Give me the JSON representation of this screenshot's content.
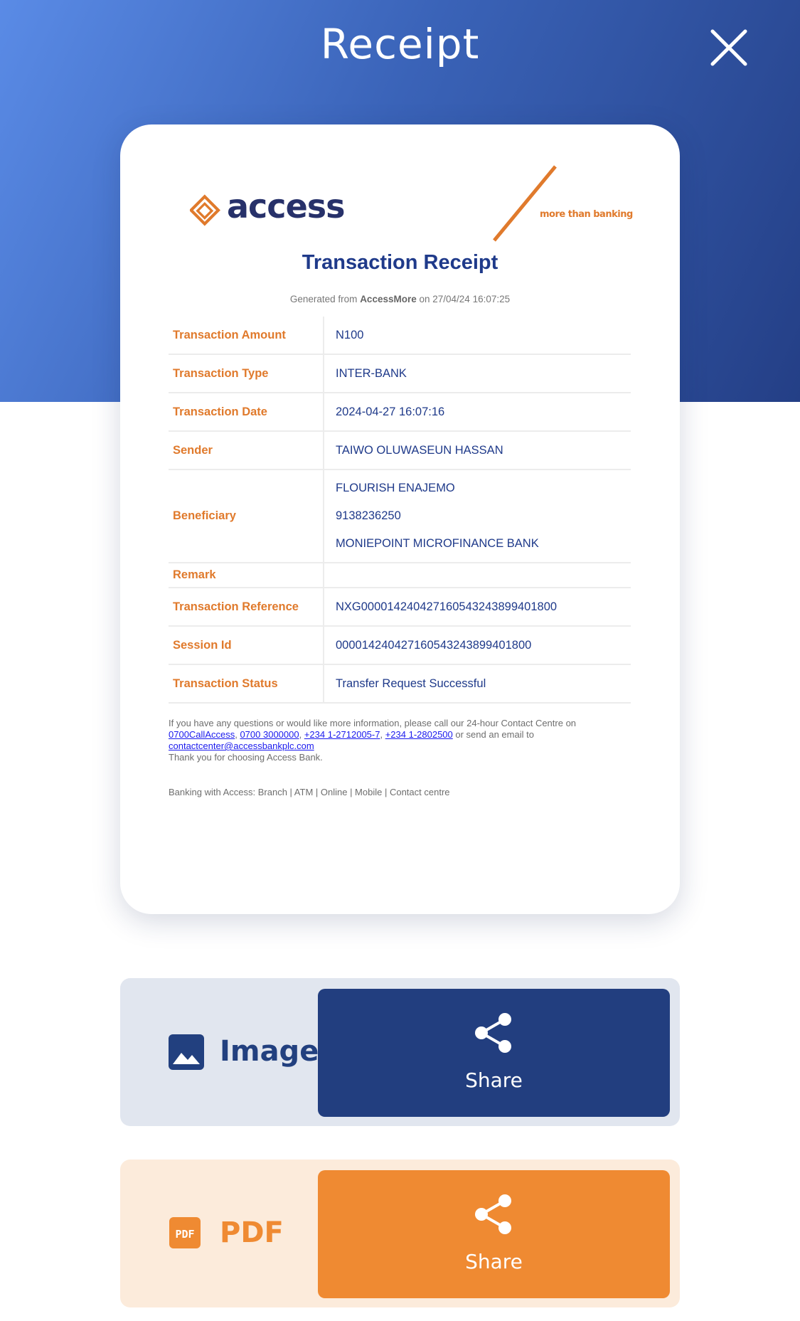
{
  "header": {
    "title": "Receipt",
    "close_icon": "close-icon"
  },
  "receipt": {
    "logo_text": "access",
    "tagline": "more than banking",
    "title": "Transaction Receipt",
    "generated_prefix": "Generated from",
    "generated_app": "AccessMore",
    "generated_suffix": "on 27/04/24 16:07:25",
    "rows": {
      "amount": {
        "label": "Transaction Amount",
        "value": "N100"
      },
      "type": {
        "label": "Transaction Type",
        "value": "INTER-BANK"
      },
      "date": {
        "label": "Transaction Date",
        "value": "2024-04-27 16:07:16"
      },
      "sender": {
        "label": "Sender",
        "value": "TAIWO OLUWASEUN HASSAN"
      },
      "beneficiary": {
        "label": "Beneficiary",
        "name": "FLOURISH ENAJEMO",
        "account": "9138236250",
        "bank": "MONIEPOINT MICROFINANCE BANK"
      },
      "remark": {
        "label": "Remark",
        "value": ""
      },
      "reference": {
        "label": "Transaction Reference",
        "value": "NXG000014240427160543243899401800"
      },
      "session": {
        "label": "Session Id",
        "value": "000014240427160543243899401800"
      },
      "status": {
        "label": "Transaction Status",
        "value": "Transfer Request Successful"
      }
    },
    "footer": {
      "intro": "If you have any questions or would like more information, please call our 24-hour Contact Centre on",
      "phone1": "0700CallAccess",
      "phone2": "0700 3000000",
      "phone3": "+234 1-2712005-7",
      "phone4": "+234 1-2802500",
      "email_intro": "or send an email to",
      "email": "contactcenter@accessbankplc.com",
      "thanks": "Thank you for choosing Access Bank.",
      "channels": "Banking with Access: Branch | ATM | Online | Mobile | Contact centre"
    }
  },
  "share_options": {
    "image": {
      "label": "Image",
      "icon": "image-icon",
      "button_label": "Share",
      "button_icon": "share-icon"
    },
    "pdf": {
      "label": "PDF",
      "icon": "pdf-icon",
      "button_label": "Share",
      "button_icon": "share-icon"
    }
  },
  "colors": {
    "header_gradient_start": "#5a8be6",
    "header_gradient_end": "#243f86",
    "brand_navy": "#1f3a8a",
    "brand_orange": "#e07a2c",
    "image_button": "#223e7f",
    "pdf_button": "#ef8a32"
  }
}
